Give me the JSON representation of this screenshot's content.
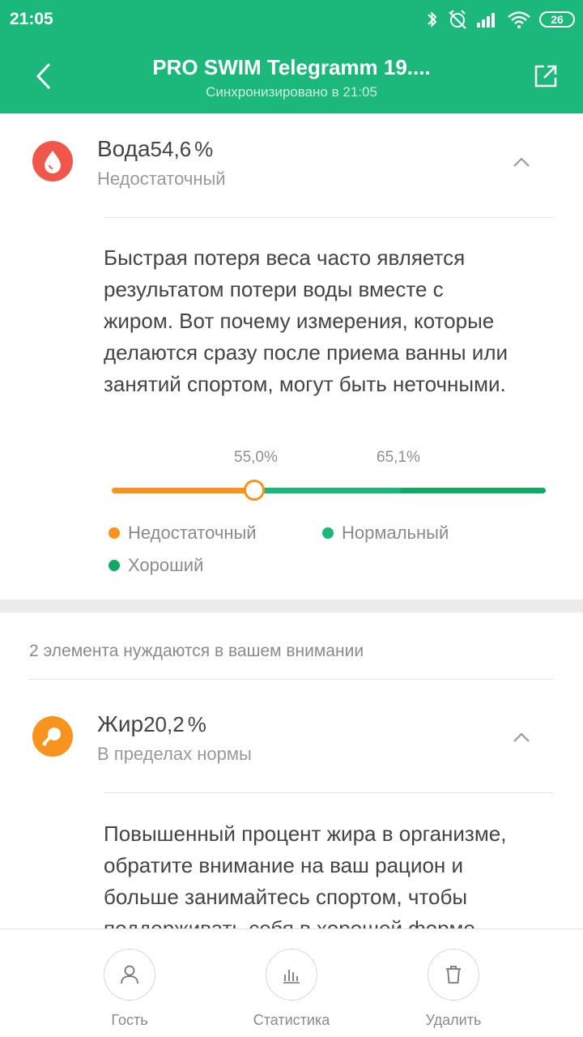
{
  "status_bar": {
    "time": "21:05",
    "battery": "26"
  },
  "header": {
    "title": "PRO SWIM Telegramm 19....",
    "subtitle": "Синхронизировано в 21:05"
  },
  "water": {
    "name": "Вода",
    "value": "54,6",
    "unit": "%",
    "status": "Недостаточный",
    "description_lines": [
      "Быстрая потеря веса часто является",
      "результатом потери воды вместе с",
      "жиром. Вот почему измерения, которые",
      "делаются сразу после приема ванны или",
      "занятий спортом, могут быть неточными."
    ],
    "scale": {
      "value_percent": 54.6,
      "thresholds": [
        "55,0%",
        "65,1%"
      ],
      "legend": {
        "low": "Недостаточный",
        "normal": "Нормальный",
        "good": "Хороший"
      },
      "colors": {
        "low": "#f7931e",
        "normal": "#1cb77a",
        "good": "#12a866"
      }
    }
  },
  "attention_text": "2 элемента нуждаются в вашем внимании",
  "fat": {
    "name": "Жир",
    "value": "20,2",
    "unit": "%",
    "status": "В пределах нормы",
    "description_lines": [
      "Повышенный процент жира в организме,",
      "обратите внимание на ваш рацион и",
      "больше занимайтесь спортом, чтобы",
      "поддерживать себя в хорошей форме."
    ]
  },
  "bottom_nav": {
    "guest": "Гость",
    "stats": "Статистика",
    "delete": "Удалить"
  },
  "colors": {
    "accent": "#1cb77a",
    "water_icon": "#f0574a",
    "fat_icon": "#f7931e"
  }
}
